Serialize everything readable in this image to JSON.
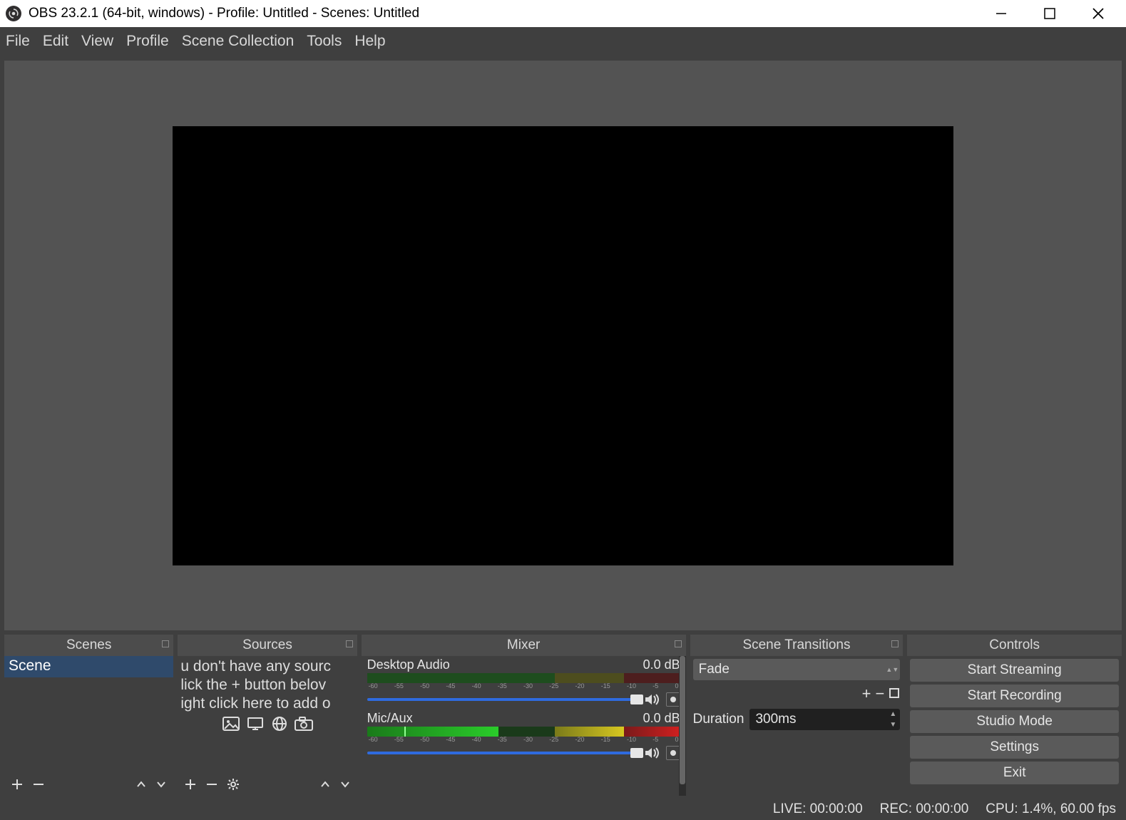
{
  "titlebar": {
    "title": "OBS 23.2.1 (64-bit, windows) - Profile: Untitled - Scenes: Untitled"
  },
  "menu": {
    "file": "File",
    "edit": "Edit",
    "view": "View",
    "profile": "Profile",
    "scene_collection": "Scene Collection",
    "tools": "Tools",
    "help": "Help"
  },
  "docks": {
    "scenes": {
      "title": "Scenes",
      "items": [
        "Scene"
      ]
    },
    "sources": {
      "title": "Sources",
      "placeholder_l1": "u don't have any sourc",
      "placeholder_l2": "lick the + button belov",
      "placeholder_l3": "ight click here to add o"
    },
    "mixer": {
      "title": "Mixer",
      "channels": [
        {
          "name": "Desktop Audio",
          "level": "0.0 dB"
        },
        {
          "name": "Mic/Aux",
          "level": "0.0 dB"
        }
      ],
      "ticks": [
        "-60",
        "-55",
        "-50",
        "-45",
        "-40",
        "-35",
        "-30",
        "-25",
        "-20",
        "-15",
        "-10",
        "-5",
        "0"
      ]
    },
    "transitions": {
      "title": "Scene Transitions",
      "selected": "Fade",
      "duration_label": "Duration",
      "duration_value": "300ms"
    },
    "controls": {
      "title": "Controls",
      "buttons": [
        "Start Streaming",
        "Start Recording",
        "Studio Mode",
        "Settings",
        "Exit"
      ]
    }
  },
  "status": {
    "live": "LIVE: 00:00:00",
    "rec": "REC: 00:00:00",
    "cpu": "CPU: 1.4%, 60.00 fps"
  }
}
